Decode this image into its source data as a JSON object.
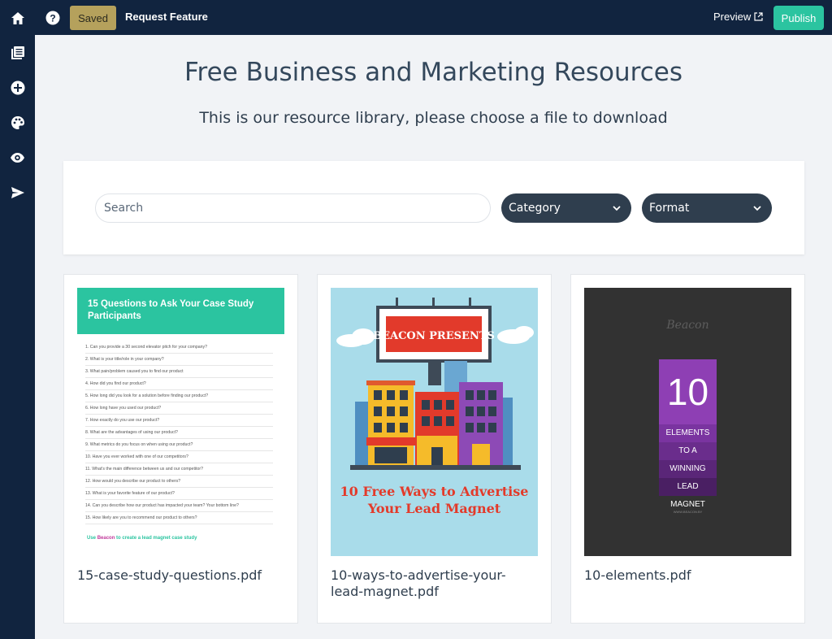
{
  "topbar": {
    "saved_label": "Saved",
    "request_feature_label": "Request Feature",
    "preview_label": "Preview",
    "publish_label": "Publish"
  },
  "page": {
    "title": "Free Business and Marketing Resources",
    "subtitle": "This is our resource library, please choose a file to download"
  },
  "filters": {
    "search_placeholder": "Search",
    "category_label": "Category",
    "format_label": "Format"
  },
  "resources": [
    {
      "file_name": "15-case-study-questions.pdf",
      "cover_title": "15 Questions to Ask Your Case Study Participants",
      "questions": [
        "1. Can you provide a 30 second elevator pitch for your company?",
        "2. What is your title/role in your company?",
        "3. What pain/problem caused you to find our product",
        "4. How did you find our product?",
        "5. How long did you look for a solution before finding our product?",
        "6. How long have you used our product?",
        "7. How exactly do you use our product?",
        "8. What are the advantages of using our product?",
        "9. What metrics do you focus on when using our product?",
        "10. Have you ever worked with one of our competitors?",
        "11. What's the main difference between us and our competitor?",
        "12. How would you describe our product to others?",
        "13. What is your favorite feature of our product?",
        "14. Can you describe how our product has impacted your team? Your bottom line?",
        "15. How likely are you to recommend our product to others?"
      ],
      "footer_prefix": "Use",
      "footer_brand": "Beacon",
      "footer_suffix": "to create a lead magnet case study"
    },
    {
      "file_name": "10-ways-to-advertise-your-lead-magnet.pdf",
      "billboard_text": "BEACON PRESENTS",
      "cover_title": "10 Free Ways to Advertise Your Lead Magnet"
    },
    {
      "file_name": "10-elements.pdf",
      "brand": "Beacon",
      "number": "10",
      "lines": [
        "ELEMENTS",
        "TO A",
        "WINNING",
        "LEAD MAGNET"
      ],
      "url": "WWW.BEACON.BY"
    }
  ],
  "colors": {
    "nav_bg": "#11243f",
    "saved_bg": "#b5a15c",
    "publish_bg": "#2bc4a0",
    "select_bg": "#2f3e4e",
    "page_bg": "#f1f3f6"
  },
  "icons": {
    "topbar": [
      "home-icon",
      "help-icon",
      "external-link-icon"
    ],
    "sidebar": [
      "pages-icon",
      "add-icon",
      "palette-icon",
      "eye-icon",
      "send-icon"
    ],
    "filters": [
      "chevron-down-icon"
    ]
  }
}
